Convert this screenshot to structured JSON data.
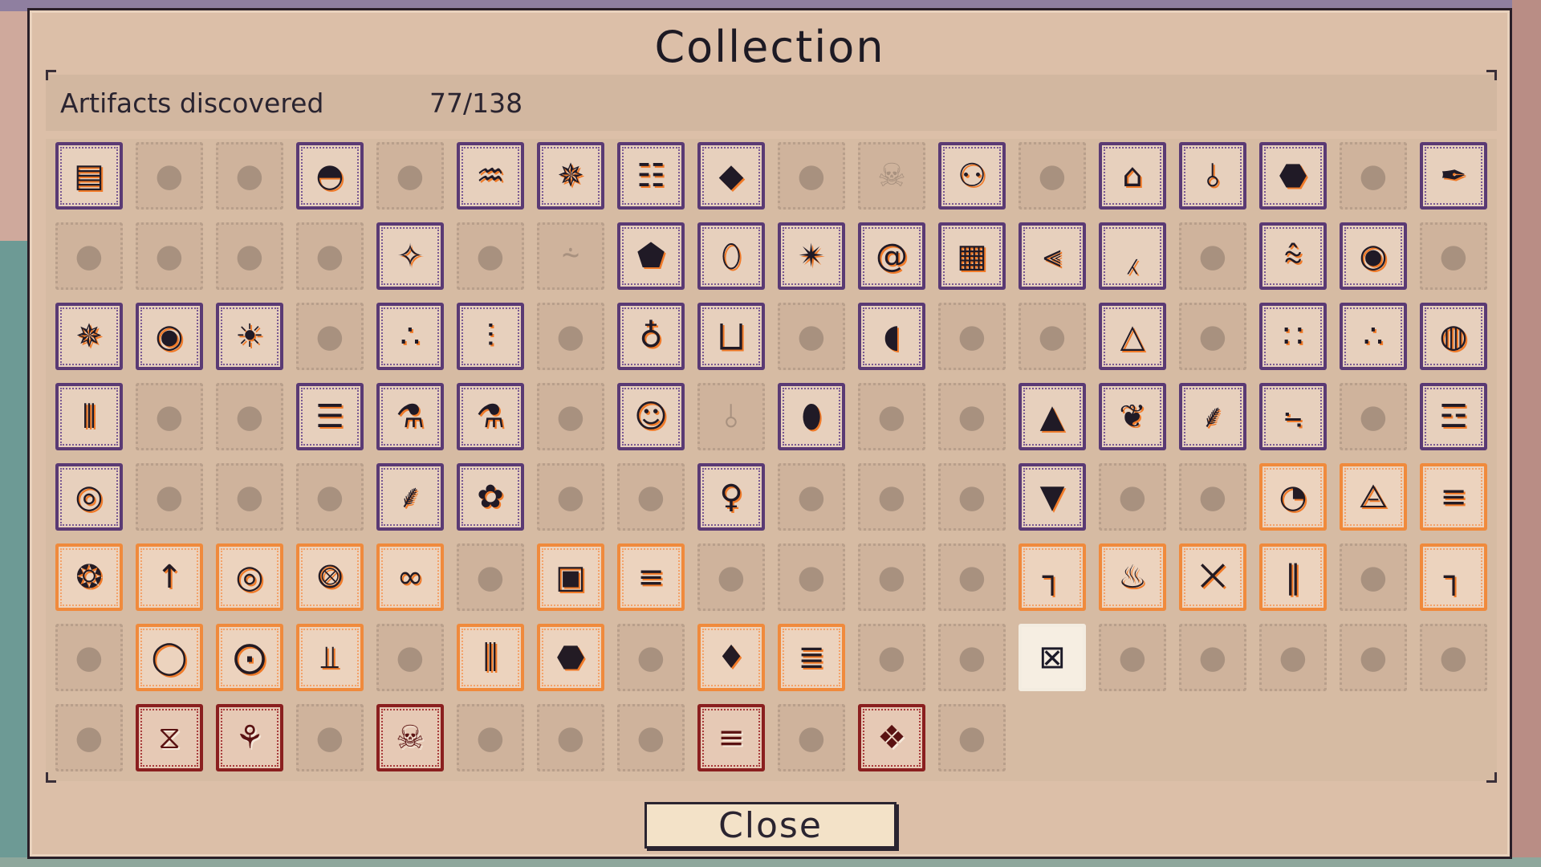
{
  "dialog": {
    "title": "Collection",
    "artifacts_label": "Artifacts discovered",
    "artifacts_count": "77/138",
    "close_label": "Close"
  },
  "colors": {
    "purple_frame": "#5a3a74",
    "orange_frame": "#f08a3c",
    "red_frame": "#8a1f1f",
    "locked_tile": "#cfb39c",
    "accent": "#f07a28"
  },
  "tiles": [
    {
      "state": "purple",
      "icon": "box-arrows-icon"
    },
    {
      "state": "locked",
      "icon": "fish-icon"
    },
    {
      "state": "locked",
      "icon": "spiral-icon"
    },
    {
      "state": "purple",
      "icon": "sunrise-icon"
    },
    {
      "state": "locked",
      "icon": "feather-icon"
    },
    {
      "state": "purple",
      "icon": "lamp-icon"
    },
    {
      "state": "purple",
      "icon": "star-burst-icon"
    },
    {
      "state": "purple",
      "icon": "cart-icon"
    },
    {
      "state": "purple",
      "icon": "diamond-arm-icon"
    },
    {
      "state": "locked",
      "icon": "log-icon"
    },
    {
      "state": "locked",
      "icon": "skull-icon"
    },
    {
      "state": "purple",
      "icon": "balls-icon"
    },
    {
      "state": "locked",
      "icon": "bug-icon"
    },
    {
      "state": "purple",
      "icon": "dome-icon"
    },
    {
      "state": "purple",
      "icon": "fountain-icon"
    },
    {
      "state": "purple",
      "icon": "beetle-icon"
    },
    {
      "state": "locked",
      "icon": "bread-icon"
    },
    {
      "state": "purple",
      "icon": "quill-icon"
    },
    {
      "state": "locked",
      "icon": "comb-icon"
    },
    {
      "state": "locked",
      "icon": "pot-icon"
    },
    {
      "state": "locked",
      "icon": "squid-icon"
    },
    {
      "state": "locked",
      "icon": "branch-icon"
    },
    {
      "state": "purple",
      "icon": "crystal-icon"
    },
    {
      "state": "locked",
      "icon": "splash-icon"
    },
    {
      "state": "locked",
      "icon": "shell-icon"
    },
    {
      "state": "purple",
      "icon": "robot-icon"
    },
    {
      "state": "purple",
      "icon": "vase-icon"
    },
    {
      "state": "purple",
      "icon": "spark-icon"
    },
    {
      "state": "purple",
      "icon": "snail-icon"
    },
    {
      "state": "purple",
      "icon": "grid-icon"
    },
    {
      "state": "purple",
      "icon": "helix-icon"
    },
    {
      "state": "purple",
      "icon": "wand-icon"
    },
    {
      "state": "locked",
      "icon": "cup-icon"
    },
    {
      "state": "purple",
      "icon": "fringe-icon"
    },
    {
      "state": "purple",
      "icon": "target-icon"
    },
    {
      "state": "locked",
      "icon": "cat-icon"
    },
    {
      "state": "purple",
      "icon": "web-icon"
    },
    {
      "state": "purple",
      "icon": "flame-eye-icon"
    },
    {
      "state": "purple",
      "icon": "sun-icon"
    },
    {
      "state": "locked",
      "icon": "horseshoe-icon"
    },
    {
      "state": "purple",
      "icon": "scatter-icon"
    },
    {
      "state": "purple",
      "icon": "totem-icon"
    },
    {
      "state": "locked",
      "icon": "leaf-icon"
    },
    {
      "state": "purple",
      "icon": "bottle-icon"
    },
    {
      "state": "purple",
      "icon": "mushroom-icon"
    },
    {
      "state": "locked",
      "icon": "tools-icon"
    },
    {
      "state": "purple",
      "icon": "pacman-icon"
    },
    {
      "state": "locked",
      "icon": "fence-icon"
    },
    {
      "state": "locked",
      "icon": "goblet-icon"
    },
    {
      "state": "purple",
      "icon": "pyramid-icon"
    },
    {
      "state": "locked",
      "icon": "ghost-icon"
    },
    {
      "state": "purple",
      "icon": "dots-icon"
    },
    {
      "state": "purple",
      "icon": "network-icon"
    },
    {
      "state": "purple",
      "icon": "orb-icon"
    },
    {
      "state": "purple",
      "icon": "drum-icon"
    },
    {
      "state": "locked",
      "icon": "blob-icon"
    },
    {
      "state": "locked",
      "icon": "door-icon"
    },
    {
      "state": "purple",
      "icon": "list-icon"
    },
    {
      "state": "purple",
      "icon": "microscope-icon"
    },
    {
      "state": "purple",
      "icon": "flask-icon"
    },
    {
      "state": "locked",
      "icon": "coil-icon"
    },
    {
      "state": "purple",
      "icon": "face-icon"
    },
    {
      "state": "locked",
      "icon": "fountain-icon"
    },
    {
      "state": "purple",
      "icon": "capsule-icon"
    },
    {
      "state": "locked",
      "icon": "root-icon"
    },
    {
      "state": "locked",
      "icon": "cloud-icon"
    },
    {
      "state": "purple",
      "icon": "tent-icon"
    },
    {
      "state": "purple",
      "icon": "shrimp-icon"
    },
    {
      "state": "purple",
      "icon": "jelly-icon"
    },
    {
      "state": "purple",
      "icon": "cactus-icon"
    },
    {
      "state": "locked",
      "icon": "rock-icon"
    },
    {
      "state": "purple",
      "icon": "battery-icon"
    },
    {
      "state": "purple",
      "icon": "ripple-icon"
    },
    {
      "state": "locked",
      "icon": "dust-icon"
    },
    {
      "state": "locked",
      "icon": "wave-icon"
    },
    {
      "state": "locked",
      "icon": "rack-icon"
    },
    {
      "state": "purple",
      "icon": "lizard-icon"
    },
    {
      "state": "purple",
      "icon": "flower-icon"
    },
    {
      "state": "locked",
      "icon": "fork-icon"
    },
    {
      "state": "locked",
      "icon": "tree-icon"
    },
    {
      "state": "purple",
      "icon": "bulb-icon"
    },
    {
      "state": "locked",
      "icon": "bones-icon"
    },
    {
      "state": "locked",
      "icon": "horn-icon"
    },
    {
      "state": "locked",
      "icon": "claw-icon"
    },
    {
      "state": "purple",
      "icon": "torch-icon"
    },
    {
      "state": "locked",
      "icon": "splat-icon"
    },
    {
      "state": "locked",
      "icon": "swirl-icon"
    },
    {
      "state": "orange",
      "icon": "radar-icon"
    },
    {
      "state": "orange",
      "icon": "robot-bug-icon"
    },
    {
      "state": "orange",
      "icon": "signal-icon"
    },
    {
      "state": "orange",
      "icon": "galaxy-icon"
    },
    {
      "state": "orange",
      "icon": "rocket-icon"
    },
    {
      "state": "orange",
      "icon": "globe-icon"
    },
    {
      "state": "orange",
      "icon": "cat-robot-icon"
    },
    {
      "state": "orange",
      "icon": "rings-icon"
    },
    {
      "state": "locked",
      "icon": "cone-icon"
    },
    {
      "state": "orange",
      "icon": "machine-icon"
    },
    {
      "state": "orange",
      "icon": "ladder-icon"
    },
    {
      "state": "locked",
      "icon": "blob-icon"
    },
    {
      "state": "locked",
      "icon": "pin-icon"
    },
    {
      "state": "locked",
      "icon": "cylinder-icon"
    },
    {
      "state": "locked",
      "icon": "crack-icon"
    },
    {
      "state": "orange",
      "icon": "pipe-icon"
    },
    {
      "state": "orange",
      "icon": "fire-icon"
    },
    {
      "state": "orange",
      "icon": "mask-icon"
    },
    {
      "state": "orange",
      "icon": "bracket-icon"
    },
    {
      "state": "locked",
      "icon": "cross-icon"
    },
    {
      "state": "orange",
      "icon": "claw-arm-icon"
    },
    {
      "state": "locked",
      "icon": "chandelier-icon"
    },
    {
      "state": "orange",
      "icon": "ring-icon"
    },
    {
      "state": "orange",
      "icon": "saucer-icon"
    },
    {
      "state": "orange",
      "icon": "cannon-icon"
    },
    {
      "state": "locked",
      "icon": "tree-icon"
    },
    {
      "state": "orange",
      "icon": "tubes-icon"
    },
    {
      "state": "orange",
      "icon": "beetle-icon"
    },
    {
      "state": "locked",
      "icon": "bow-icon"
    },
    {
      "state": "orange",
      "icon": "bag-icon"
    },
    {
      "state": "orange",
      "icon": "bee-icon"
    },
    {
      "state": "locked",
      "icon": "chart-icon"
    },
    {
      "state": "locked",
      "icon": "column-icon"
    },
    {
      "state": "white",
      "icon": "screen-icon"
    },
    {
      "state": "locked",
      "icon": "smoke-icon"
    },
    {
      "state": "locked",
      "icon": "rock-icon"
    },
    {
      "state": "locked",
      "icon": "square-icon"
    },
    {
      "state": "locked",
      "icon": "grass-icon"
    },
    {
      "state": "locked",
      "icon": "splat-icon"
    },
    {
      "state": "locked",
      "icon": "cabinet-icon"
    },
    {
      "state": "red",
      "icon": "hourglass-icon"
    },
    {
      "state": "red",
      "icon": "coral-icon"
    },
    {
      "state": "locked",
      "icon": "circle-icon"
    },
    {
      "state": "red",
      "icon": "skull-icon"
    },
    {
      "state": "locked",
      "icon": "mound-icon"
    },
    {
      "state": "locked",
      "icon": "circle-icon"
    },
    {
      "state": "locked",
      "icon": "octagon-icon"
    },
    {
      "state": "red",
      "icon": "bench-icon"
    },
    {
      "state": "locked",
      "icon": "bars-icon"
    },
    {
      "state": "red",
      "icon": "confetti-icon"
    },
    {
      "state": "locked",
      "icon": "maze-icon"
    }
  ]
}
